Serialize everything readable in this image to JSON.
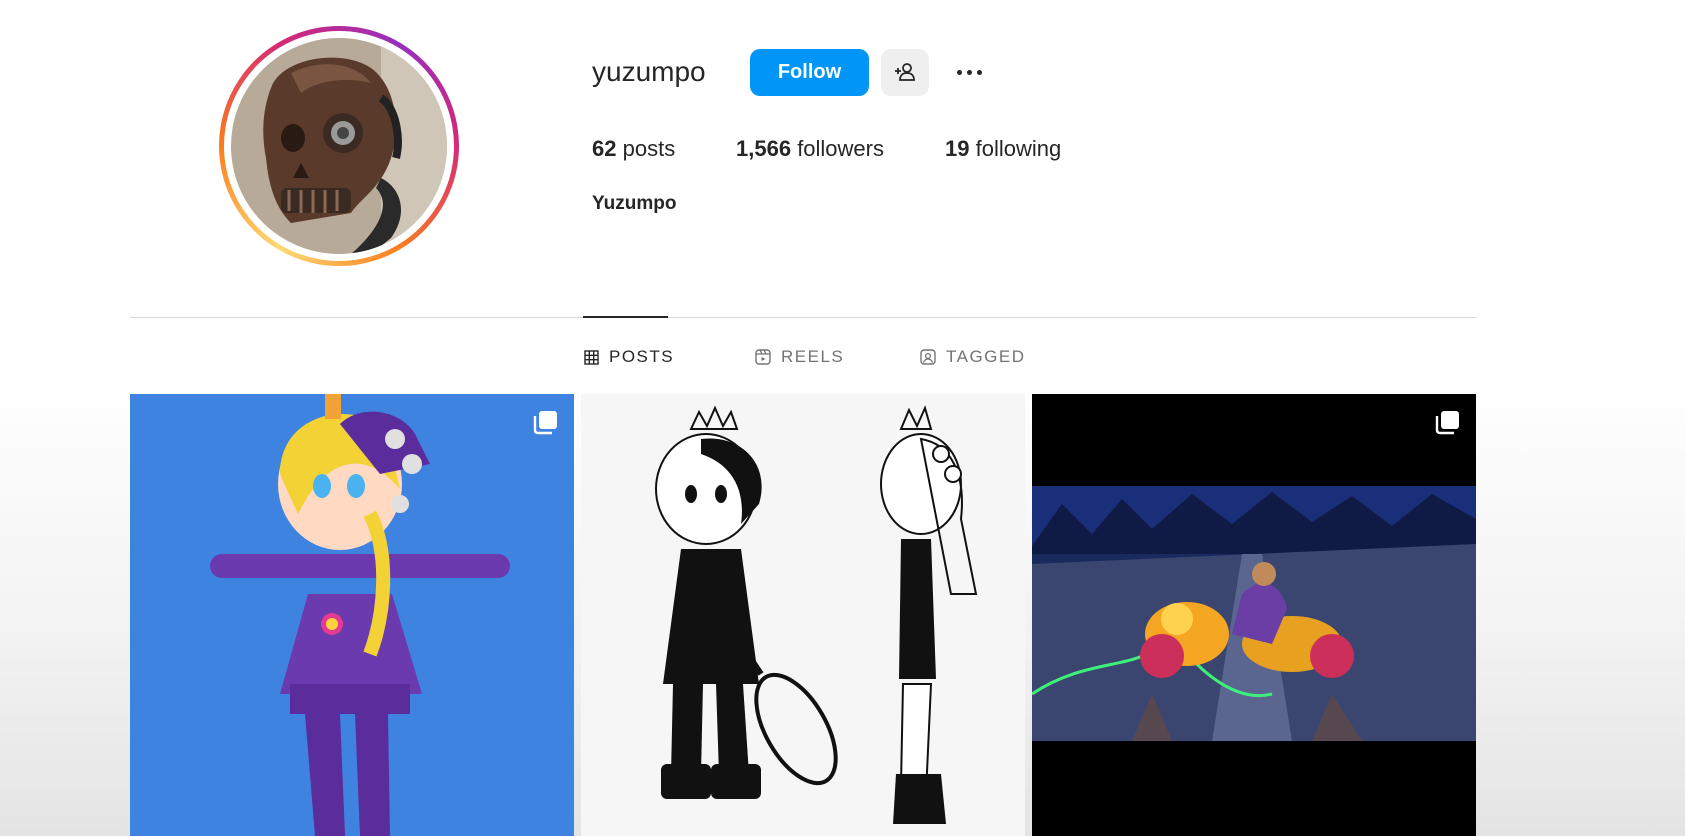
{
  "profile": {
    "username": "yuzumpo",
    "full_name": "Yuzumpo",
    "avatar": "skull-avatar",
    "follow_label": "Follow",
    "suggest_icon": "add-person-icon",
    "more_icon": "more-options-icon",
    "stats": {
      "posts_count": "62",
      "posts_label": "posts",
      "followers_count": "1,566",
      "followers_label": "followers",
      "following_count": "19",
      "following_label": "following"
    }
  },
  "tabs": [
    {
      "label": "POSTS",
      "icon": "grid-icon",
      "active": true
    },
    {
      "label": "REELS",
      "icon": "reels-icon",
      "active": false
    },
    {
      "label": "TAGGED",
      "icon": "tagged-icon",
      "active": false
    }
  ],
  "posts": [
    {
      "description": "3d-character-blue-background",
      "multi": true
    },
    {
      "description": "sketch-character-sheet",
      "multi": false
    },
    {
      "description": "motorcycle-night-scene",
      "multi": true
    }
  ],
  "colors": {
    "accent": "#0095f6",
    "text": "#262626",
    "muted": "#737373",
    "ring": [
      "#feda75",
      "#fa7e1e",
      "#d62976",
      "#962fbf"
    ]
  }
}
